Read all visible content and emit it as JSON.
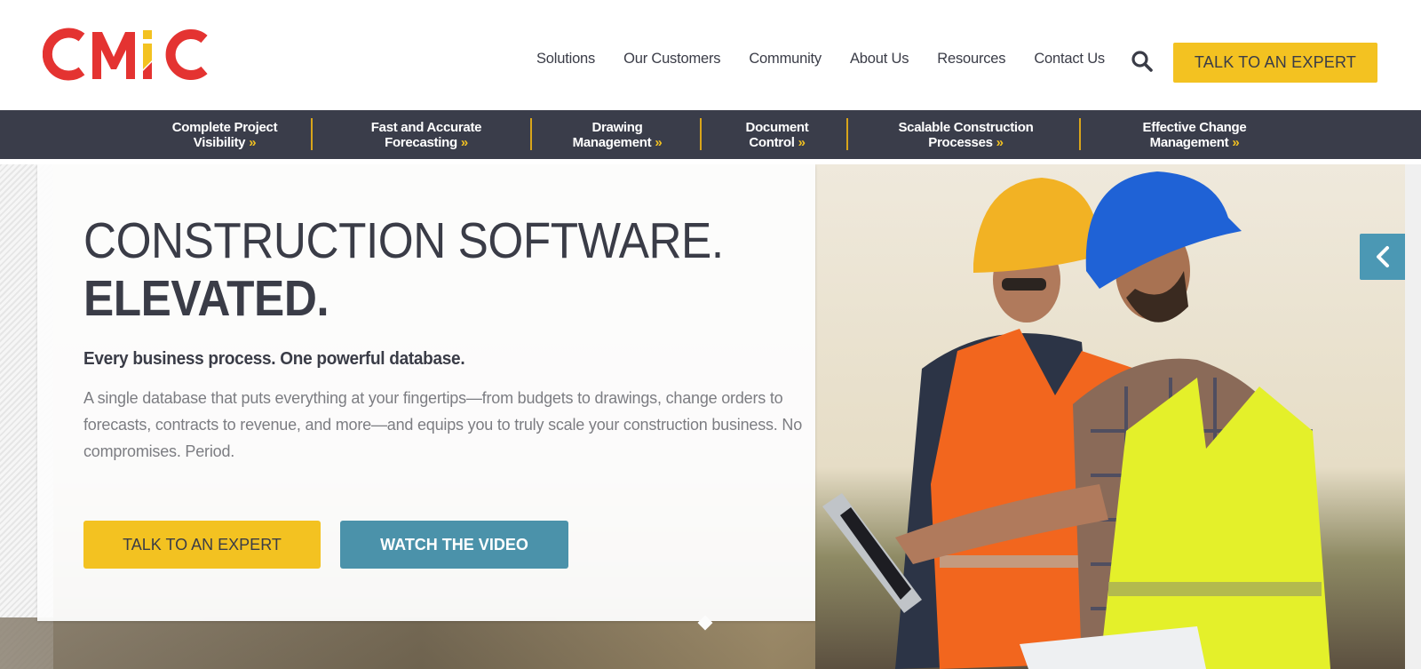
{
  "brand": {
    "name": "CMiC",
    "colors": {
      "red": "#e43331",
      "yellow": "#f3c221",
      "dark": "#3a3d4a",
      "teal": "#4b92aa"
    }
  },
  "header": {
    "nav": [
      "Solutions",
      "Our Customers",
      "Community",
      "About Us",
      "Resources",
      "Contact Us"
    ],
    "search_icon": "search-icon",
    "cta_label": "TALK TO AN EXPERT"
  },
  "subnav": {
    "chevron": "»",
    "items": [
      {
        "line1": "Complete Project",
        "line2": "Visibility"
      },
      {
        "line1": "Fast and Accurate",
        "line2": "Forecasting"
      },
      {
        "line1": "Drawing",
        "line2": "Management"
      },
      {
        "line1": "Document",
        "line2": "Control"
      },
      {
        "line1": "Scalable Construction",
        "line2": "Processes"
      },
      {
        "line1": "Effective Change",
        "line2": "Management"
      }
    ]
  },
  "hero": {
    "headline_line1": "CONSTRUCTION SOFTWARE.",
    "headline_line2": "ELEVATED.",
    "subheadline": "Every business process. One powerful database.",
    "body": "A single database that puts everything at your fingertips—from budgets to drawings, change orders to forecasts, contracts to revenue, and more—and equips you to truly scale your construction business. No compromises. Period.",
    "primary_button": "TALK TO AN EXPERT",
    "secondary_button": "WATCH THE VIDEO",
    "image_alt": "Two construction workers in hard hats and safety vests looking at a tablet",
    "carousel_prev_icon": "chevron-left-icon"
  }
}
